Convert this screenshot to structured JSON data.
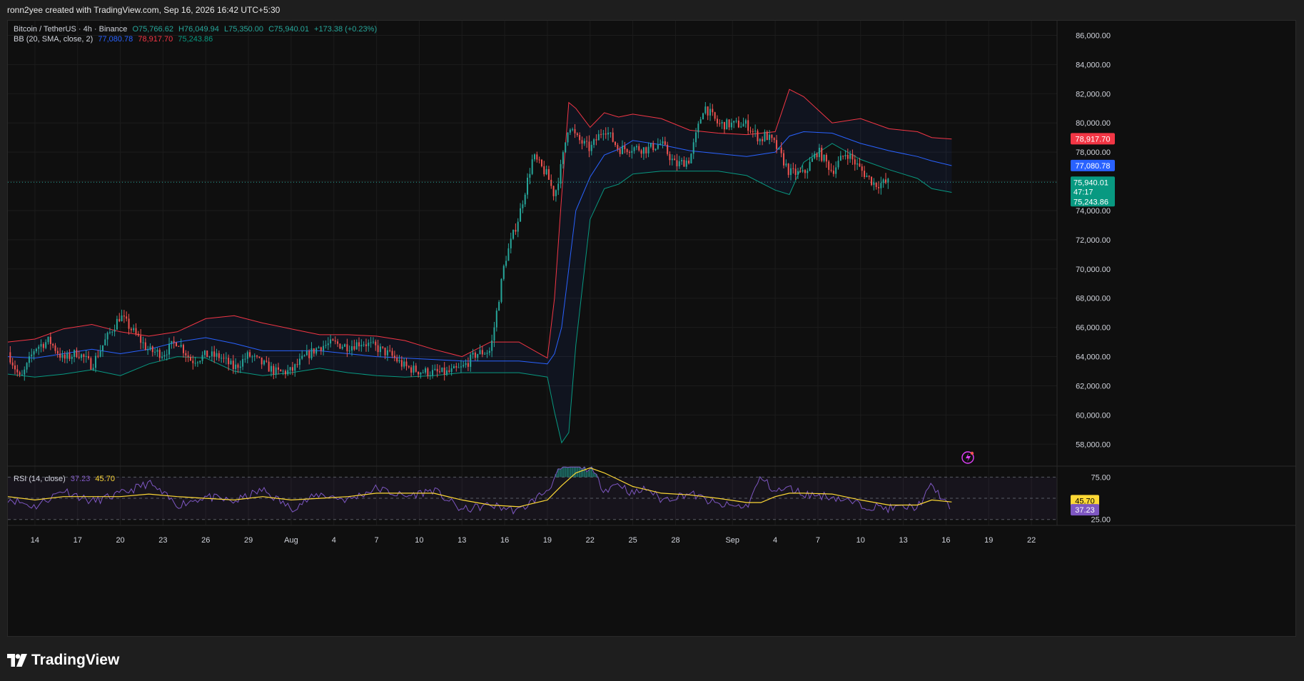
{
  "header": {
    "caption": "ronn2yee created with TradingView.com, Sep 16, 2026 16:42 UTC+5:30"
  },
  "legend": {
    "symbol": "Bitcoin / TetherUS · 4h · Binance",
    "open": "O75,766.62",
    "high": "H76,049.94",
    "low": "L75,350.00",
    "close": "C75,940.01",
    "change": "+173.38 (+0.23%)",
    "bb_label": "BB (20, SMA, close, 2)",
    "bb_basis": "77,080.78",
    "bb_upper": "78,917.70",
    "bb_lower": "75,243.86",
    "rsi_label": "RSI (14, close)",
    "rsi_value": "37.23",
    "rsi_ma": "45.70"
  },
  "price_badges": {
    "upper": "78,917.70",
    "basis": "77,080.78",
    "last": "75,940.01",
    "countdown": "47:17",
    "lower": "75,243.86",
    "rsi_ma": "45.70",
    "rsi": "37.23"
  },
  "footer": {
    "brand": "TradingView"
  },
  "colors": {
    "background": "#0f0f0f",
    "up": "#26a69a",
    "down": "#ef5350",
    "bb_upper": "#f23645",
    "bb_basis": "#2962ff",
    "bb_lower": "#089981",
    "rsi": "#7e57c2",
    "rsi_ma": "#fdd835"
  },
  "chart_data": [
    {
      "type": "candlestick",
      "title": "Bitcoin / TetherUS · 4h · Binance",
      "ylim": [
        56500,
        87000
      ],
      "y_ticks": [
        58000,
        60000,
        62000,
        64000,
        66000,
        68000,
        70000,
        72000,
        74000,
        76000,
        78000,
        80000,
        82000,
        84000,
        86000
      ],
      "y_tick_labels": [
        "58,000.00",
        "60,000.00",
        "62,000.00",
        "64,000.00",
        "66,000.00",
        "68,000.00",
        "70,000.00",
        "72,000.00",
        "74,000.00",
        "76,000.00",
        "78,000.00",
        "80,000.00",
        "82,000.00",
        "84,000.00",
        "86,000.00"
      ],
      "x_tick_labels": [
        "14",
        "17",
        "20",
        "23",
        "26",
        "29",
        "Aug",
        "4",
        "7",
        "10",
        "13",
        "16",
        "19",
        "22",
        "25",
        "28",
        "Sep",
        "4",
        "7",
        "10",
        "13",
        "16",
        "19",
        "22"
      ],
      "x_tick_days": [
        14,
        17,
        20,
        23,
        26,
        29,
        32,
        35,
        38,
        41,
        44,
        47,
        50,
        53,
        56,
        59,
        63,
        66,
        69,
        72,
        75,
        78,
        81,
        84
      ],
      "x_range_days": [
        12.1,
        85.8
      ],
      "last_day": 78.4,
      "grid": true,
      "close_path_days": [
        12.1,
        13,
        14,
        15,
        16,
        17,
        18,
        19,
        20,
        21,
        22,
        23,
        24,
        25,
        26,
        27,
        28,
        29,
        30,
        31,
        32,
        33,
        34,
        35,
        36,
        37,
        38,
        39,
        40,
        41,
        42,
        43,
        44,
        45,
        46,
        47,
        48,
        49,
        50,
        50.5,
        51,
        51.5,
        52,
        53,
        54,
        55,
        56,
        57,
        58,
        59,
        60,
        61,
        62,
        63,
        64,
        65,
        65.3,
        66,
        67,
        68,
        69,
        70,
        71,
        72,
        73,
        74,
        75,
        76,
        76.6,
        77,
        77.5,
        78,
        78.4
      ],
      "close_path": [
        64300,
        62400,
        64600,
        65100,
        63800,
        64300,
        63400,
        65200,
        66800,
        65600,
        64400,
        64200,
        65100,
        63700,
        64100,
        64000,
        63200,
        64100,
        63500,
        62900,
        63000,
        64000,
        64700,
        64900,
        64700,
        65000,
        64600,
        64100,
        63300,
        63000,
        62900,
        62900,
        63200,
        64200,
        64400,
        70500,
        73600,
        77700,
        76400,
        75000,
        77200,
        80000,
        79000,
        78200,
        79700,
        78200,
        78300,
        78200,
        78600,
        77100,
        77500,
        81200,
        79900,
        79900,
        79900,
        78800,
        79200,
        78500,
        76600,
        76500,
        78100,
        76700,
        78000,
        76800,
        75800,
        75940
      ],
      "bb_upper": [
        65000,
        65200,
        65900,
        66200,
        65700,
        65400,
        65700,
        66600,
        66800,
        66300,
        65900,
        65500,
        65500,
        65400,
        65100,
        64500,
        64000,
        65000,
        65000,
        63900,
        68000,
        75000,
        81400,
        81000,
        79700,
        80700,
        80400,
        80600,
        80300,
        79500,
        79300,
        79200,
        79400,
        82300,
        81800,
        80000,
        80300,
        79600,
        79400,
        79000,
        78900
      ],
      "bb_basis": [
        64000,
        63900,
        64200,
        64500,
        64200,
        64500,
        65000,
        65300,
        64900,
        64400,
        64400,
        64400,
        64200,
        64000,
        63900,
        63800,
        63700,
        63700,
        63700,
        63500,
        64200,
        66000,
        70000,
        74000,
        76300,
        77800,
        78200,
        78800,
        78500,
        78100,
        77900,
        77700,
        78000,
        79100,
        79400,
        79300,
        78600,
        78100,
        77700,
        77400,
        77080
      ],
      "bb_lower": [
        62800,
        62600,
        62800,
        63100,
        62700,
        63500,
        64000,
        63900,
        63000,
        62700,
        62900,
        63200,
        62900,
        62700,
        62600,
        62700,
        62900,
        62900,
        62900,
        62600,
        60200,
        58100,
        58800,
        64800,
        73400,
        75500,
        75800,
        76500,
        76700,
        76700,
        76700,
        76400,
        75400,
        75100,
        77300,
        78600,
        77500,
        76800,
        76200,
        75500,
        75243
      ],
      "bb_days": [
        12.1,
        14,
        16,
        18,
        20,
        22,
        24,
        26,
        28,
        30,
        32,
        34,
        36,
        38,
        40,
        42,
        44,
        46,
        48,
        50,
        50.5,
        51,
        51.5,
        52,
        53,
        54,
        55,
        56,
        58,
        60,
        62,
        64,
        66,
        67,
        68,
        70,
        72,
        74,
        76,
        77,
        78.4
      ]
    },
    {
      "type": "line",
      "title": "RSI (14, close)",
      "ylim": [
        18,
        88
      ],
      "y_ticks": [
        25,
        75
      ],
      "y_tick_labels": [
        "25.00",
        "75.00"
      ],
      "days": [
        12.1,
        14,
        16,
        18,
        20,
        22,
        24,
        26,
        28,
        30,
        32,
        34,
        36,
        38,
        40,
        42,
        44,
        46,
        48,
        50,
        51,
        52,
        53,
        54,
        55,
        56,
        57,
        58,
        60,
        62,
        64,
        65,
        66,
        67,
        68,
        70,
        72,
        74,
        76,
        77,
        78.4
      ],
      "rsi": [
        50,
        40,
        60,
        46,
        55,
        68,
        42,
        52,
        46,
        60,
        38,
        55,
        48,
        62,
        52,
        60,
        36,
        42,
        35,
        60,
        86,
        90,
        85,
        60,
        68,
        55,
        62,
        48,
        56,
        42,
        40,
        75,
        58,
        62,
        55,
        52,
        42,
        38,
        40,
        65,
        37.23
      ],
      "rsi_ma": [
        52,
        48,
        52,
        52,
        52,
        55,
        52,
        50,
        48,
        52,
        48,
        50,
        52,
        56,
        56,
        56,
        48,
        42,
        40,
        48,
        65,
        80,
        86,
        80,
        72,
        64,
        60,
        56,
        54,
        50,
        45,
        45,
        52,
        56,
        56,
        55,
        48,
        42,
        42,
        48,
        45.7
      ]
    }
  ]
}
